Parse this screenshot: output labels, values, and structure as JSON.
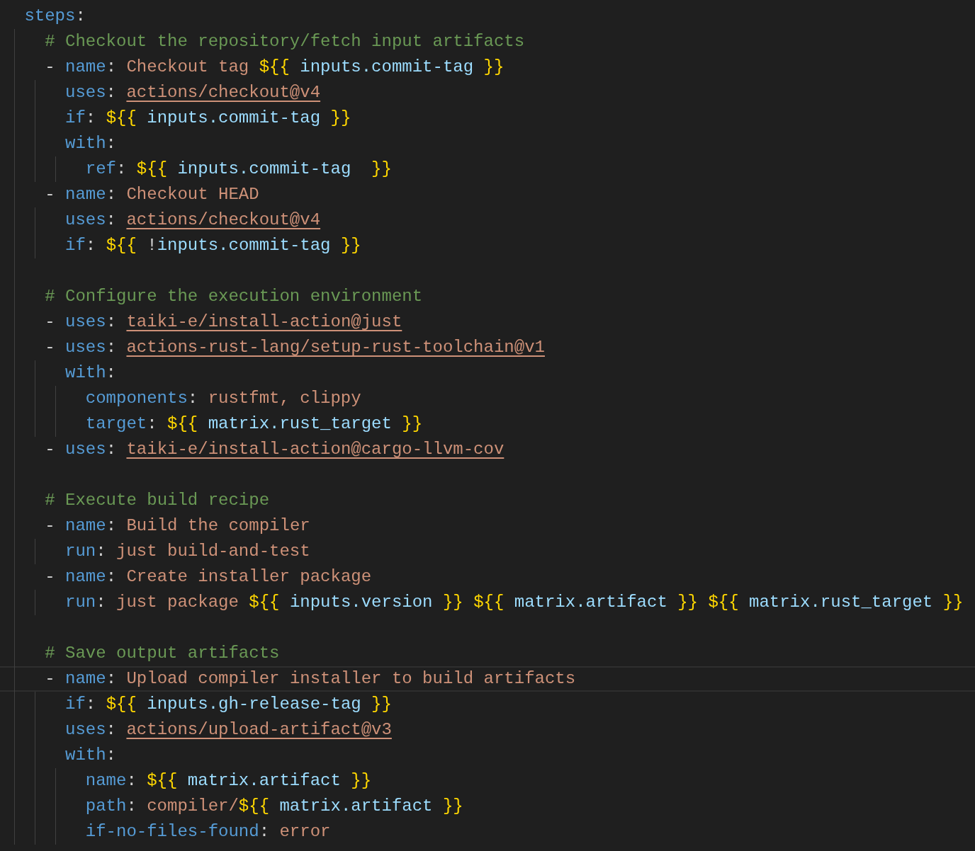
{
  "editor": {
    "lines": [
      {
        "current": false,
        "tokens": [
          {
            "kind": "key",
            "text": "steps"
          },
          {
            "kind": "punct",
            "text": ":"
          }
        ],
        "children": [
          {
            "current": false,
            "tokens": [
              {
                "kind": "comment",
                "text": "# Checkout the repository/fetch input artifacts"
              }
            ]
          },
          {
            "current": false,
            "tokens": [
              {
                "kind": "punct",
                "text": "- "
              },
              {
                "kind": "key",
                "text": "name"
              },
              {
                "kind": "punct",
                "text": ": "
              },
              {
                "kind": "str",
                "text": "Checkout tag "
              },
              {
                "kind": "brace",
                "text": "${{"
              },
              {
                "kind": "var",
                "text": " inputs.commit-tag "
              },
              {
                "kind": "brace",
                "text": "}}"
              }
            ],
            "children": [
              {
                "current": false,
                "tokens": [
                  {
                    "kind": "key",
                    "text": "uses"
                  },
                  {
                    "kind": "punct",
                    "text": ": "
                  },
                  {
                    "kind": "link",
                    "text": "actions/checkout@v4"
                  }
                ]
              },
              {
                "current": false,
                "tokens": [
                  {
                    "kind": "key",
                    "text": "if"
                  },
                  {
                    "kind": "punct",
                    "text": ": "
                  },
                  {
                    "kind": "brace",
                    "text": "${{"
                  },
                  {
                    "kind": "var",
                    "text": " inputs.commit-tag "
                  },
                  {
                    "kind": "brace",
                    "text": "}}"
                  }
                ]
              },
              {
                "current": false,
                "tokens": [
                  {
                    "kind": "key",
                    "text": "with"
                  },
                  {
                    "kind": "punct",
                    "text": ":"
                  }
                ],
                "children": [
                  {
                    "current": false,
                    "tokens": [
                      {
                        "kind": "key",
                        "text": "ref"
                      },
                      {
                        "kind": "punct",
                        "text": ": "
                      },
                      {
                        "kind": "brace",
                        "text": "${{"
                      },
                      {
                        "kind": "var",
                        "text": " inputs.commit-tag  "
                      },
                      {
                        "kind": "brace",
                        "text": "}}"
                      }
                    ]
                  }
                ]
              }
            ]
          },
          {
            "current": false,
            "tokens": [
              {
                "kind": "punct",
                "text": "- "
              },
              {
                "kind": "key",
                "text": "name"
              },
              {
                "kind": "punct",
                "text": ": "
              },
              {
                "kind": "str",
                "text": "Checkout HEAD"
              }
            ],
            "children": [
              {
                "current": false,
                "tokens": [
                  {
                    "kind": "key",
                    "text": "uses"
                  },
                  {
                    "kind": "punct",
                    "text": ": "
                  },
                  {
                    "kind": "link",
                    "text": "actions/checkout@v4"
                  }
                ]
              },
              {
                "current": false,
                "tokens": [
                  {
                    "kind": "key",
                    "text": "if"
                  },
                  {
                    "kind": "punct",
                    "text": ": "
                  },
                  {
                    "kind": "brace",
                    "text": "${{"
                  },
                  {
                    "kind": "punct",
                    "text": " !"
                  },
                  {
                    "kind": "var",
                    "text": "inputs.commit-tag "
                  },
                  {
                    "kind": "brace",
                    "text": "}}"
                  }
                ]
              }
            ]
          },
          {
            "current": false
          },
          {
            "current": false,
            "tokens": [
              {
                "kind": "comment",
                "text": "# Configure the execution environment"
              }
            ]
          },
          {
            "current": false,
            "tokens": [
              {
                "kind": "punct",
                "text": "- "
              },
              {
                "kind": "key",
                "text": "uses"
              },
              {
                "kind": "punct",
                "text": ": "
              },
              {
                "kind": "link",
                "text": "taiki-e/install-action@just"
              }
            ]
          },
          {
            "current": false,
            "tokens": [
              {
                "kind": "punct",
                "text": "- "
              },
              {
                "kind": "key",
                "text": "uses"
              },
              {
                "kind": "punct",
                "text": ": "
              },
              {
                "kind": "link",
                "text": "actions-rust-lang/setup-rust-toolchain@v1"
              }
            ],
            "children": [
              {
                "current": false,
                "tokens": [
                  {
                    "kind": "key",
                    "text": "with"
                  },
                  {
                    "kind": "punct",
                    "text": ":"
                  }
                ],
                "children": [
                  {
                    "current": false,
                    "tokens": [
                      {
                        "kind": "key",
                        "text": "components"
                      },
                      {
                        "kind": "punct",
                        "text": ": "
                      },
                      {
                        "kind": "str",
                        "text": "rustfmt, clippy"
                      }
                    ]
                  },
                  {
                    "current": false,
                    "tokens": [
                      {
                        "kind": "key",
                        "text": "target"
                      },
                      {
                        "kind": "punct",
                        "text": ": "
                      },
                      {
                        "kind": "brace",
                        "text": "${{"
                      },
                      {
                        "kind": "var",
                        "text": " matrix.rust_target "
                      },
                      {
                        "kind": "brace",
                        "text": "}}"
                      }
                    ]
                  }
                ]
              }
            ]
          },
          {
            "current": false,
            "tokens": [
              {
                "kind": "punct",
                "text": "- "
              },
              {
                "kind": "key",
                "text": "uses"
              },
              {
                "kind": "punct",
                "text": ": "
              },
              {
                "kind": "link",
                "text": "taiki-e/install-action@cargo-llvm-cov"
              }
            ]
          },
          {
            "current": false
          },
          {
            "current": false,
            "tokens": [
              {
                "kind": "comment",
                "text": "# Execute build recipe"
              }
            ]
          },
          {
            "current": false,
            "tokens": [
              {
                "kind": "punct",
                "text": "- "
              },
              {
                "kind": "key",
                "text": "name"
              },
              {
                "kind": "punct",
                "text": ": "
              },
              {
                "kind": "str",
                "text": "Build the compiler"
              }
            ],
            "children": [
              {
                "current": false,
                "tokens": [
                  {
                    "kind": "key",
                    "text": "run"
                  },
                  {
                    "kind": "punct",
                    "text": ": "
                  },
                  {
                    "kind": "str",
                    "text": "just build-and-test"
                  }
                ]
              }
            ]
          },
          {
            "current": false,
            "tokens": [
              {
                "kind": "punct",
                "text": "- "
              },
              {
                "kind": "key",
                "text": "name"
              },
              {
                "kind": "punct",
                "text": ": "
              },
              {
                "kind": "str",
                "text": "Create installer package"
              }
            ],
            "children": [
              {
                "current": false,
                "tokens": [
                  {
                    "kind": "key",
                    "text": "run"
                  },
                  {
                    "kind": "punct",
                    "text": ": "
                  },
                  {
                    "kind": "str",
                    "text": "just package "
                  },
                  {
                    "kind": "brace",
                    "text": "${{"
                  },
                  {
                    "kind": "var",
                    "text": " inputs.version "
                  },
                  {
                    "kind": "brace",
                    "text": "}} ${{"
                  },
                  {
                    "kind": "var",
                    "text": " matrix.artifact "
                  },
                  {
                    "kind": "brace",
                    "text": "}} ${{"
                  },
                  {
                    "kind": "var",
                    "text": " matrix.rust_target "
                  },
                  {
                    "kind": "brace",
                    "text": "}}"
                  }
                ]
              }
            ]
          },
          {
            "current": false
          },
          {
            "current": false,
            "tokens": [
              {
                "kind": "comment",
                "text": "# Save output artifacts"
              }
            ]
          },
          {
            "current": true,
            "tokens": [
              {
                "kind": "punct",
                "text": "- "
              },
              {
                "kind": "key",
                "text": "name"
              },
              {
                "kind": "punct",
                "text": ": "
              },
              {
                "kind": "str",
                "text": "Upload compiler installer to build artifacts"
              }
            ],
            "children": [
              {
                "current": false,
                "tokens": [
                  {
                    "kind": "key",
                    "text": "if"
                  },
                  {
                    "kind": "punct",
                    "text": ": "
                  },
                  {
                    "kind": "brace",
                    "text": "${{"
                  },
                  {
                    "kind": "var",
                    "text": " inputs.gh-release-tag "
                  },
                  {
                    "kind": "brace",
                    "text": "}}"
                  }
                ]
              },
              {
                "current": false,
                "tokens": [
                  {
                    "kind": "key",
                    "text": "uses"
                  },
                  {
                    "kind": "punct",
                    "text": ": "
                  },
                  {
                    "kind": "link",
                    "text": "actions/upload-artifact@v3"
                  }
                ]
              },
              {
                "current": false,
                "tokens": [
                  {
                    "kind": "key",
                    "text": "with"
                  },
                  {
                    "kind": "punct",
                    "text": ":"
                  }
                ],
                "children": [
                  {
                    "current": false,
                    "tokens": [
                      {
                        "kind": "key",
                        "text": "name"
                      },
                      {
                        "kind": "punct",
                        "text": ": "
                      },
                      {
                        "kind": "brace",
                        "text": "${{"
                      },
                      {
                        "kind": "var",
                        "text": " matrix.artifact "
                      },
                      {
                        "kind": "brace",
                        "text": "}}"
                      }
                    ]
                  },
                  {
                    "current": false,
                    "tokens": [
                      {
                        "kind": "key",
                        "text": "path"
                      },
                      {
                        "kind": "punct",
                        "text": ": "
                      },
                      {
                        "kind": "str",
                        "text": "compiler/"
                      },
                      {
                        "kind": "brace",
                        "text": "${{"
                      },
                      {
                        "kind": "var",
                        "text": " matrix.artifact "
                      },
                      {
                        "kind": "brace",
                        "text": "}}"
                      }
                    ]
                  },
                  {
                    "current": false,
                    "tokens": [
                      {
                        "kind": "key",
                        "text": "if-no-files-found"
                      },
                      {
                        "kind": "punct",
                        "text": ": "
                      },
                      {
                        "kind": "str",
                        "text": "error"
                      }
                    ]
                  }
                ]
              }
            ]
          }
        ]
      }
    ]
  }
}
